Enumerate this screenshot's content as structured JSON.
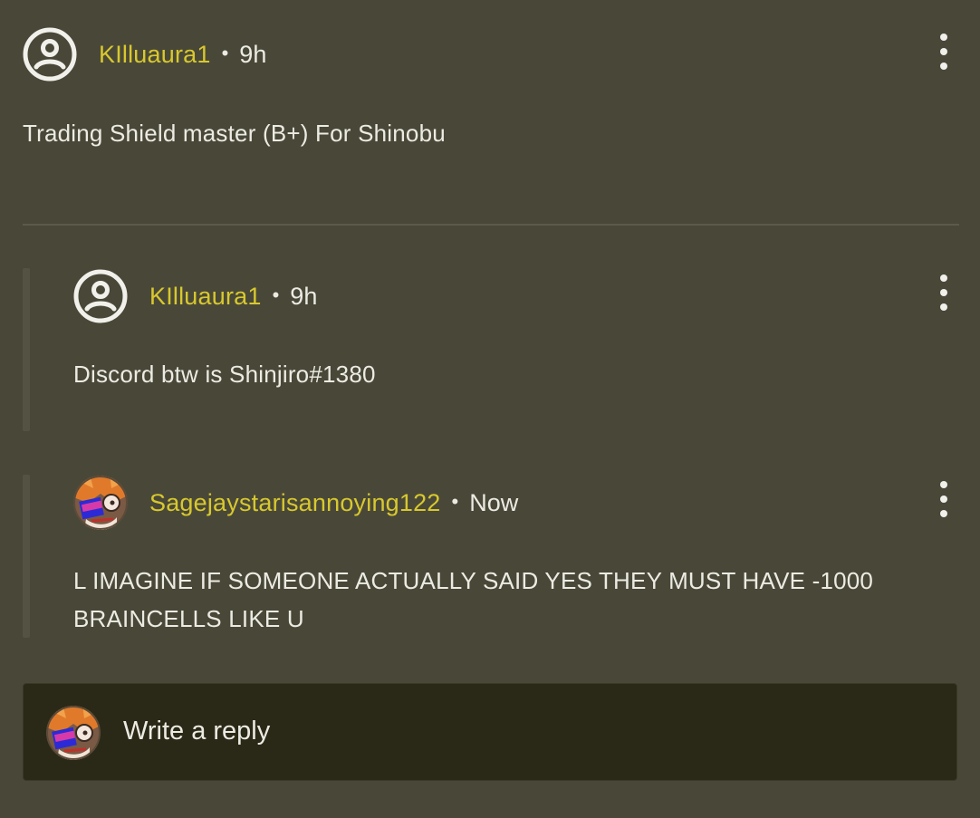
{
  "comments": [
    {
      "username": "KIlluaura1",
      "separator": "•",
      "time": "9h",
      "text": "Trading Shield master (B+) For Shinobu",
      "avatar_icon": "default-user-icon"
    }
  ],
  "replies": [
    {
      "username": "KIlluaura1",
      "separator": "•",
      "time": "9h",
      "text": "Discord btw is Shinjiro#1380",
      "avatar_icon": "default-user-icon"
    },
    {
      "username": "Sagejaystarisannoying122",
      "separator": "•",
      "time": "Now",
      "text_line1": "L IMAGINE IF SOMEONE ACTUALLY SAID YES THEY MUST HAVE -1000",
      "text_line2": "BRAINCELLS LIKE U",
      "avatar_icon": "user-avatar-photo"
    }
  ],
  "reply_box": {
    "placeholder": "Write a reply"
  },
  "colors": {
    "background": "#494838",
    "username": "#d8c82e",
    "text": "#ecebe3",
    "reply_box": "#2a2917"
  },
  "icons": {
    "more": "more-vertical-icon"
  }
}
